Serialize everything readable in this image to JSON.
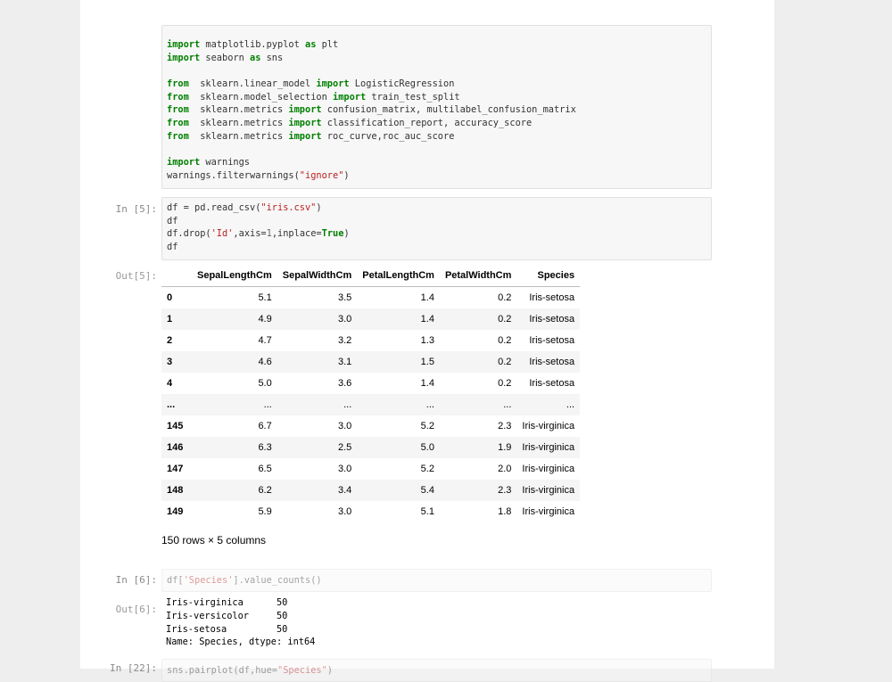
{
  "cell_imports": {
    "lines": [
      [
        [
          "kw",
          "import"
        ],
        [
          "t",
          " matplotlib.pyplot "
        ],
        [
          "kw",
          "as"
        ],
        [
          "t",
          " plt"
        ]
      ],
      [
        [
          "kw",
          "import"
        ],
        [
          "t",
          " seaborn "
        ],
        [
          "kw",
          "as"
        ],
        [
          "t",
          " sns"
        ]
      ],
      [],
      [
        [
          "kw",
          "from"
        ],
        [
          "t",
          "  sklearn.linear_model "
        ],
        [
          "kw",
          "import"
        ],
        [
          "t",
          " LogisticRegression"
        ]
      ],
      [
        [
          "kw",
          "from"
        ],
        [
          "t",
          "  sklearn.model_selection "
        ],
        [
          "kw",
          "import"
        ],
        [
          "t",
          " train_test_split"
        ]
      ],
      [
        [
          "kw",
          "from"
        ],
        [
          "t",
          "  sklearn.metrics "
        ],
        [
          "kw",
          "import"
        ],
        [
          "t",
          " confusion_matrix, multilabel_confusion_matrix"
        ]
      ],
      [
        [
          "kw",
          "from"
        ],
        [
          "t",
          "  sklearn.metrics "
        ],
        [
          "kw",
          "import"
        ],
        [
          "t",
          " classification_report, accuracy_score"
        ]
      ],
      [
        [
          "kw",
          "from"
        ],
        [
          "t",
          "  sklearn.metrics "
        ],
        [
          "kw",
          "import"
        ],
        [
          "t",
          " roc_curve,roc_auc_score"
        ]
      ],
      [],
      [
        [
          "kw",
          "import"
        ],
        [
          "t",
          " warnings"
        ]
      ],
      [
        [
          "t",
          "warnings.filterwarnings("
        ],
        [
          "str",
          "\"ignore\""
        ],
        [
          "t",
          ")"
        ]
      ]
    ]
  },
  "cell5": {
    "in_prompt": "In [5]:",
    "out_prompt": "Out[5]:",
    "lines": [
      [
        [
          "t",
          "df = pd.read_csv("
        ],
        [
          "str",
          "\"iris.csv\""
        ],
        [
          "t",
          ")"
        ]
      ],
      [
        [
          "t",
          "df"
        ]
      ],
      [
        [
          "t",
          "df.drop("
        ],
        [
          "str",
          "'Id'"
        ],
        [
          "t",
          ",axis="
        ],
        [
          "num",
          "1"
        ],
        [
          "t",
          ",inplace="
        ],
        [
          "kw",
          "True"
        ],
        [
          "t",
          ")"
        ]
      ],
      [
        [
          "t",
          "df"
        ]
      ]
    ],
    "table": {
      "columns": [
        "",
        "SepalLengthCm",
        "SepalWidthCm",
        "PetalLengthCm",
        "PetalWidthCm",
        "Species"
      ],
      "rows": [
        [
          "0",
          "5.1",
          "3.5",
          "1.4",
          "0.2",
          "Iris-setosa"
        ],
        [
          "1",
          "4.9",
          "3.0",
          "1.4",
          "0.2",
          "Iris-setosa"
        ],
        [
          "2",
          "4.7",
          "3.2",
          "1.3",
          "0.2",
          "Iris-setosa"
        ],
        [
          "3",
          "4.6",
          "3.1",
          "1.5",
          "0.2",
          "Iris-setosa"
        ],
        [
          "4",
          "5.0",
          "3.6",
          "1.4",
          "0.2",
          "Iris-setosa"
        ],
        [
          "...",
          "...",
          "...",
          "...",
          "...",
          "..."
        ],
        [
          "145",
          "6.7",
          "3.0",
          "5.2",
          "2.3",
          "Iris-virginica"
        ],
        [
          "146",
          "6.3",
          "2.5",
          "5.0",
          "1.9",
          "Iris-virginica"
        ],
        [
          "147",
          "6.5",
          "3.0",
          "5.2",
          "2.0",
          "Iris-virginica"
        ],
        [
          "148",
          "6.2",
          "3.4",
          "5.4",
          "2.3",
          "Iris-virginica"
        ],
        [
          "149",
          "5.9",
          "3.0",
          "5.1",
          "1.8",
          "Iris-virginica"
        ]
      ]
    },
    "shape_note": "150 rows × 5 columns"
  },
  "cell6": {
    "in_prompt": "In [6]:",
    "out_prompt": "Out[6]:",
    "lines": [
      [
        [
          "t",
          "df["
        ],
        [
          "str",
          "'Species'"
        ],
        [
          "t",
          "].value_counts()"
        ]
      ]
    ],
    "output": "Iris-virginica      50\nIris-versicolor     50\nIris-setosa         50\nName: Species, dtype: int64"
  },
  "cell22": {
    "in_prompt": "In [22]:",
    "lines": [
      [
        [
          "t",
          "sns.pairplot(df,hue="
        ],
        [
          "str",
          "\"Species\""
        ],
        [
          "t",
          ")"
        ]
      ]
    ]
  },
  "colors": {
    "keyword": "#008000",
    "string": "#ba2121",
    "number": "#666666",
    "prompt": "#303f9f"
  }
}
